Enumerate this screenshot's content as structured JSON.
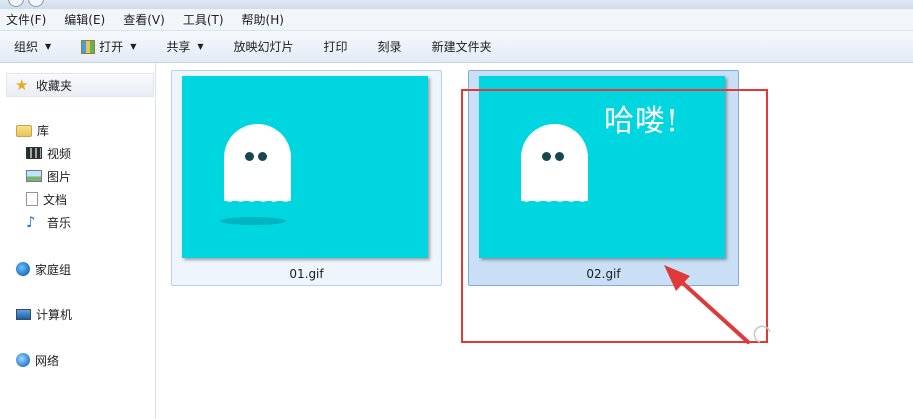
{
  "menu": [
    "文件(F)",
    "编辑(E)",
    "查看(V)",
    "工具(T)",
    "帮助(H)"
  ],
  "toolbar": {
    "organize": "组织",
    "open": "打开",
    "share": "共享",
    "slideshow": "放映幻灯片",
    "print": "打印",
    "burn": "刻录",
    "new_folder": "新建文件夹"
  },
  "nav": {
    "favorites": "收藏夹",
    "libraries": "库",
    "videos": "视频",
    "pictures": "图片",
    "documents": "文档",
    "music": "音乐",
    "homegroup": "家庭组",
    "computer": "计算机",
    "network": "网络"
  },
  "files": [
    {
      "name": "01.gif",
      "selected": false
    },
    {
      "name": "02.gif",
      "selected": true,
      "overlay_text": "哈喽!"
    }
  ],
  "colors": {
    "thumbnail_bg": "#00d6e0",
    "annotation_red": "#e0393a",
    "selection_blue": "#c9dff6"
  }
}
